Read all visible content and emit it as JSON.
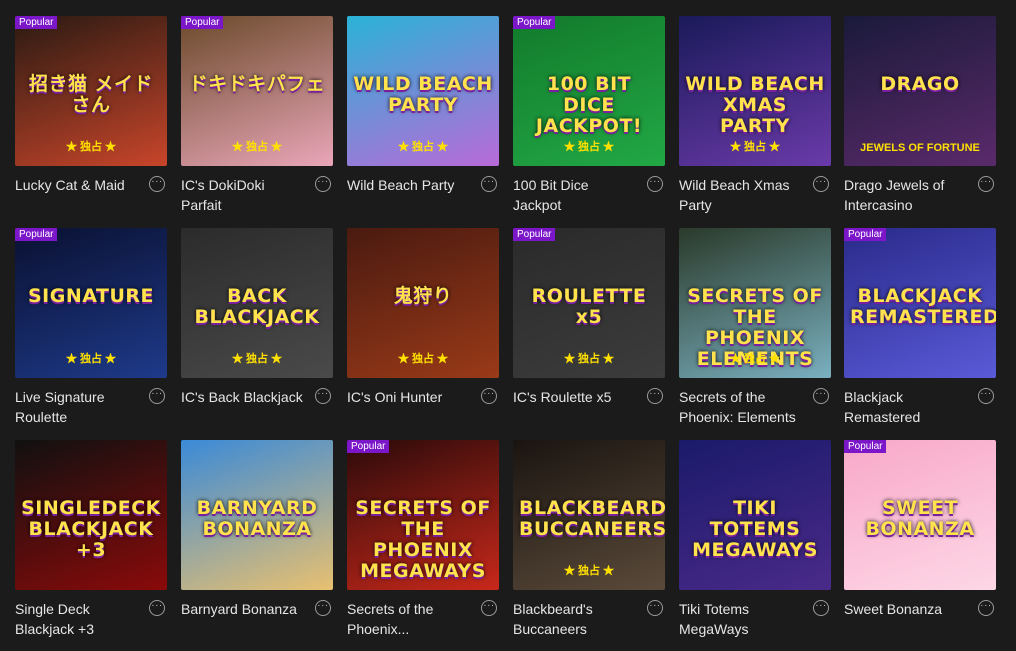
{
  "badge_label": "Popular",
  "info_icon_glyph": "···",
  "games": [
    {
      "name": "Lucky Cat & Maid",
      "popular": true,
      "art": "招き猫 メイドさん",
      "sub": "★ 独占 ★",
      "bg": "#2a1a12",
      "bg2": "#c8452a"
    },
    {
      "name": "IC's DokiDoki Parfait",
      "popular": true,
      "art": "ドキドキパフェ",
      "sub": "★ 独占 ★",
      "bg": "#6b4a2a",
      "bg2": "#e9a6b8"
    },
    {
      "name": "Wild Beach Party",
      "popular": false,
      "art": "WILD BEACH PARTY",
      "sub": "★ 独占 ★",
      "bg": "#2ab3d6",
      "bg2": "#b96ad8"
    },
    {
      "name": "100 Bit Dice Jackpot",
      "popular": true,
      "art": "100 BIT DICE JACKPOT!",
      "sub": "★ 独占 ★",
      "bg": "#127a2c",
      "bg2": "#22a845"
    },
    {
      "name": "Wild Beach Xmas Party",
      "popular": false,
      "art": "WILD BEACH XMAS PARTY",
      "sub": "★ 独占 ★",
      "bg": "#1a1a5a",
      "bg2": "#6a3aa8"
    },
    {
      "name": "Drago Jewels of Intercasino",
      "popular": false,
      "art": "DRAGO",
      "sub": "JEWELS OF FORTUNE",
      "bg": "#1a1a3a",
      "bg2": "#5a2a6a"
    },
    {
      "name": "Live Signature Roulette",
      "popular": true,
      "art": "SIGNATURE",
      "sub": "★ 独占 ★",
      "bg": "#0a1030",
      "bg2": "#1e3a8a"
    },
    {
      "name": "IC's Back Blackjack",
      "popular": false,
      "art": "BACK BLACKJACK",
      "sub": "★ 独占 ★",
      "bg": "#2b2b2b",
      "bg2": "#4a4a4a"
    },
    {
      "name": "IC's Oni Hunter",
      "popular": false,
      "art": "鬼狩り",
      "sub": "★ 独占 ★",
      "bg": "#4a1a10",
      "bg2": "#9a3a18"
    },
    {
      "name": "IC's Roulette x5",
      "popular": true,
      "art": "ROULETTE x5",
      "sub": "★ 独占 ★",
      "bg": "#2a2a2a",
      "bg2": "#3c3c3c"
    },
    {
      "name": "Secrets of the Phoenix: Elements",
      "popular": false,
      "art": "SECRETS OF THE PHOENIX ELEMENTS",
      "sub": "★ 独占 ★",
      "bg": "#2a3a2a",
      "bg2": "#7ab0c0"
    },
    {
      "name": "Blackjack Remastered",
      "popular": true,
      "art": "BLACKJACK REMASTERED",
      "sub": "",
      "bg": "#2a2a8a",
      "bg2": "#5a5ad8"
    },
    {
      "name": "Single Deck Blackjack +3",
      "popular": false,
      "art": "SINGLEDECK BLACKJACK +3",
      "sub": "",
      "bg": "#101010",
      "bg2": "#8a0a0a"
    },
    {
      "name": "Barnyard Bonanza",
      "popular": false,
      "art": "BARNYARD BONANZA",
      "sub": "",
      "bg": "#3a8ad8",
      "bg2": "#e8c070"
    },
    {
      "name": "Secrets of the Phoenix...",
      "popular": true,
      "art": "SECRETS OF THE PHOENIX MEGAWAYS",
      "sub": "",
      "bg": "#2a0a0a",
      "bg2": "#c8281a"
    },
    {
      "name": "Blackbeard's Buccaneers",
      "popular": false,
      "art": "BLACKBEARD'S BUCCANEERS",
      "sub": "★ 独占 ★",
      "bg": "#1a1410",
      "bg2": "#5a4a3a"
    },
    {
      "name": "Tiki Totems MegaWays",
      "popular": false,
      "art": "TIKI TOTEMS MEGAWAYS",
      "sub": "",
      "bg": "#1a1a6a",
      "bg2": "#4a2a8a"
    },
    {
      "name": "Sweet Bonanza",
      "popular": true,
      "art": "SWEET BONANZA",
      "sub": "",
      "bg": "#f8a8c8",
      "bg2": "#fdd7e6"
    }
  ]
}
